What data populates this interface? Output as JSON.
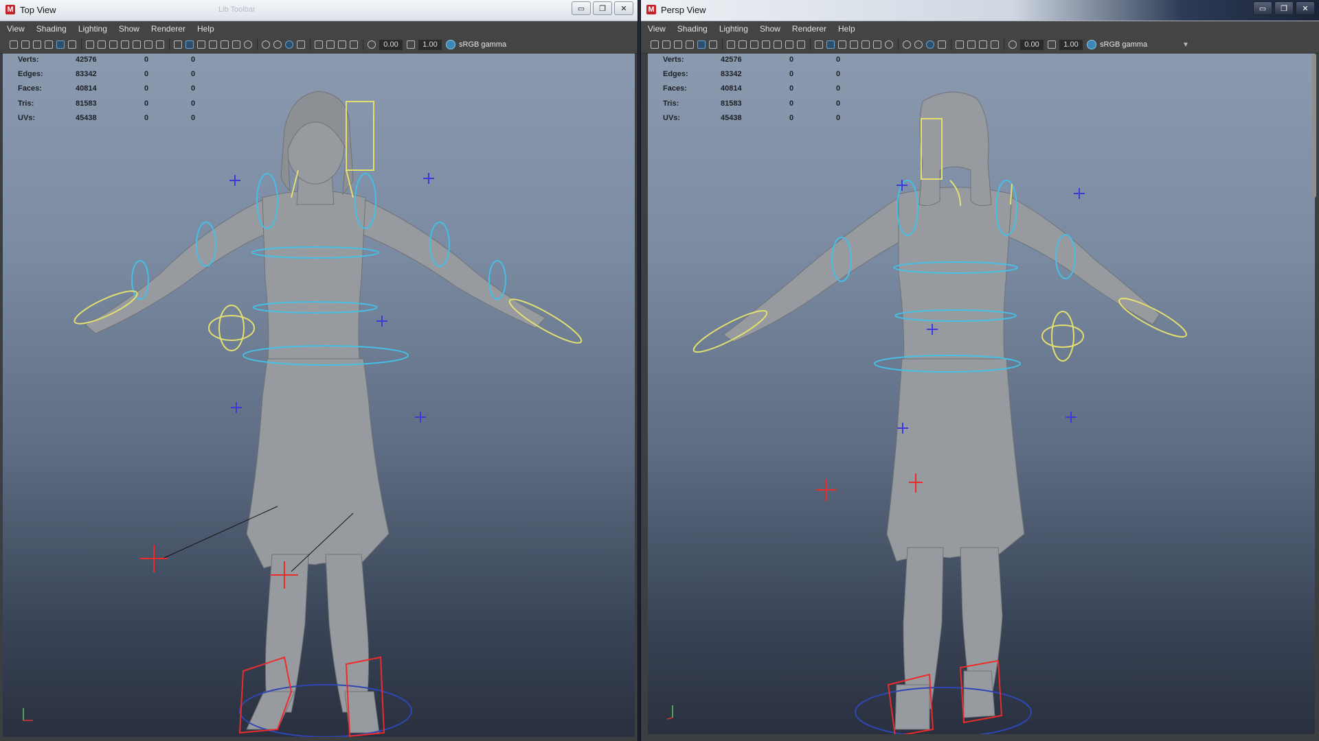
{
  "windows": [
    {
      "title": "Top View",
      "ghost_title": "Lib Toolbar",
      "menu": [
        "View",
        "Shading",
        "Lighting",
        "Show",
        "Renderer",
        "Help"
      ],
      "toolbar": {
        "field_a": "0.00",
        "field_b": "1.00",
        "color_space": "sRGB gamma"
      },
      "stats": [
        {
          "label": "Verts:",
          "value": "42576",
          "a": "0",
          "b": "0"
        },
        {
          "label": "Edges:",
          "value": "83342",
          "a": "0",
          "b": "0"
        },
        {
          "label": "Faces:",
          "value": "40814",
          "a": "0",
          "b": "0"
        },
        {
          "label": "Tris:",
          "value": "81583",
          "a": "0",
          "b": "0"
        },
        {
          "label": "UVs:",
          "value": "45438",
          "a": "0",
          "b": "0"
        }
      ]
    },
    {
      "title": "Persp View",
      "menu": [
        "View",
        "Shading",
        "Lighting",
        "Show",
        "Renderer",
        "Help"
      ],
      "toolbar": {
        "field_a": "0.00",
        "field_b": "1.00",
        "color_space": "sRGB gamma"
      },
      "stats": [
        {
          "label": "Verts:",
          "value": "42576",
          "a": "0",
          "b": "0"
        },
        {
          "label": "Edges:",
          "value": "83342",
          "a": "0",
          "b": "0"
        },
        {
          "label": "Faces:",
          "value": "40814",
          "a": "0",
          "b": "0"
        },
        {
          "label": "Tris:",
          "value": "81583",
          "a": "0",
          "b": "0"
        },
        {
          "label": "UVs:",
          "value": "45438",
          "a": "0",
          "b": "0"
        }
      ]
    }
  ],
  "colors": {
    "rig_yellow": "#e3e070",
    "rig_cyan": "#45bfe5",
    "rig_red": "#ee2b2b",
    "rig_blue": "#3d39d6",
    "model_gray": "#979a9e"
  },
  "icons": [
    "maya-logo",
    "minimize-icon",
    "maximize-icon",
    "close-icon",
    "camera-icon",
    "grid-icon",
    "wireframe-icon",
    "smooth-shade-icon",
    "light-icon",
    "color-space-icon"
  ]
}
